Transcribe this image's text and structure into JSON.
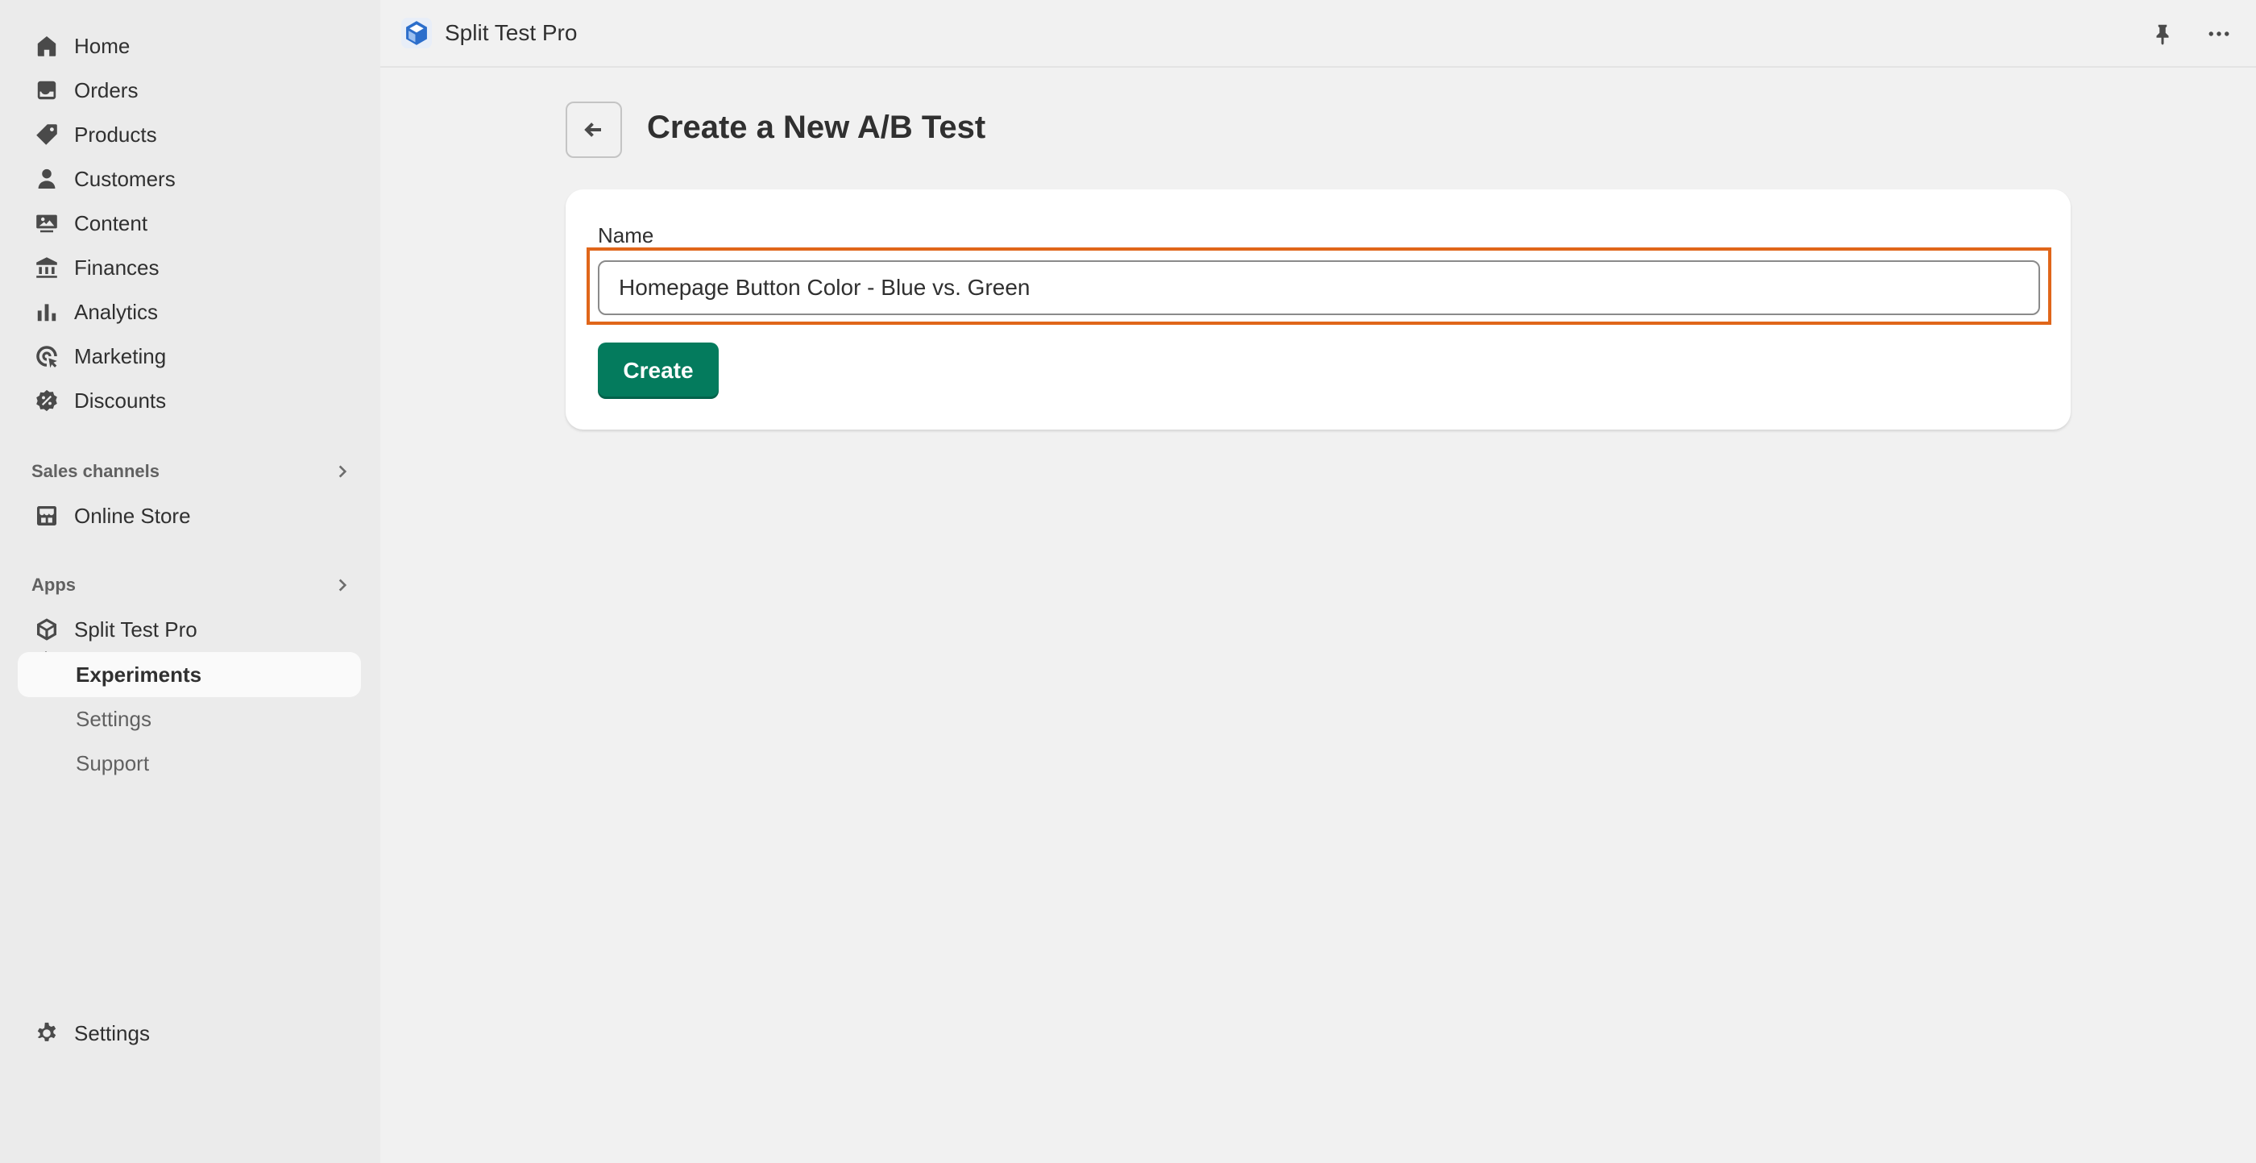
{
  "sidebar": {
    "items": [
      {
        "label": "Home",
        "icon": "home-icon"
      },
      {
        "label": "Orders",
        "icon": "inbox-icon"
      },
      {
        "label": "Products",
        "icon": "tag-icon"
      },
      {
        "label": "Customers",
        "icon": "person-icon"
      },
      {
        "label": "Content",
        "icon": "image-icon"
      },
      {
        "label": "Finances",
        "icon": "bank-icon"
      },
      {
        "label": "Analytics",
        "icon": "bar-chart-icon"
      },
      {
        "label": "Marketing",
        "icon": "target-icon"
      },
      {
        "label": "Discounts",
        "icon": "discount-icon"
      }
    ],
    "sales_channels": {
      "heading": "Sales channels",
      "items": [
        {
          "label": "Online Store",
          "icon": "store-icon"
        }
      ]
    },
    "apps": {
      "heading": "Apps",
      "app_name": "Split Test Pro",
      "sub_items": [
        {
          "label": "Experiments",
          "active": true
        },
        {
          "label": "Settings",
          "active": false
        },
        {
          "label": "Support",
          "active": false
        }
      ]
    },
    "settings_label": "Settings"
  },
  "topbar": {
    "app_title": "Split Test Pro",
    "logo_color": "#2c6ecb"
  },
  "page": {
    "title": "Create a New A/B Test"
  },
  "form": {
    "name_label": "Name",
    "name_value": "Homepage Button Color - Blue vs. Green",
    "create_label": "Create"
  },
  "colors": {
    "primary_button": "#047b5d",
    "focus_highlight": "#e0661a"
  }
}
